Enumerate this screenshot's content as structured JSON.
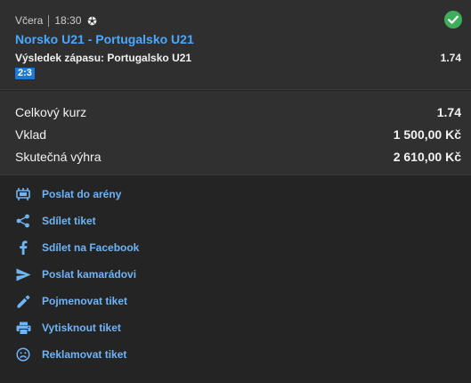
{
  "bet": {
    "day": "Včera",
    "time": "18:30",
    "sport_icon": "soccer-ball-icon",
    "status_icon": "check-circle-icon",
    "match": "Norsko U21 - Portugalsko U21",
    "selection": "Výsledek zápasu: Portugalsko U21",
    "odds": "1.74",
    "score": "2:3",
    "colors": {
      "link": "#4aa8ff",
      "win": "#3fae5a",
      "badge": "#1e7ad6"
    }
  },
  "summary": [
    {
      "label": "Celkový kurz",
      "value": "1.74"
    },
    {
      "label": "Vklad",
      "value": "1 500,00 Kč"
    },
    {
      "label": "Skutečná výhra",
      "value": "2 610,00 Kč"
    }
  ],
  "actions": [
    {
      "label": "Poslat do arény",
      "icon": "arena-icon"
    },
    {
      "label": "Sdílet tiket",
      "icon": "share-icon"
    },
    {
      "label": "Sdílet na Facebook",
      "icon": "facebook-icon"
    },
    {
      "label": "Poslat kamarádovi",
      "icon": "send-icon"
    },
    {
      "label": "Pojmenovat tiket",
      "icon": "pencil-icon"
    },
    {
      "label": "Vytisknout tiket",
      "icon": "print-icon"
    },
    {
      "label": "Reklamovat tiket",
      "icon": "complaint-icon"
    }
  ]
}
